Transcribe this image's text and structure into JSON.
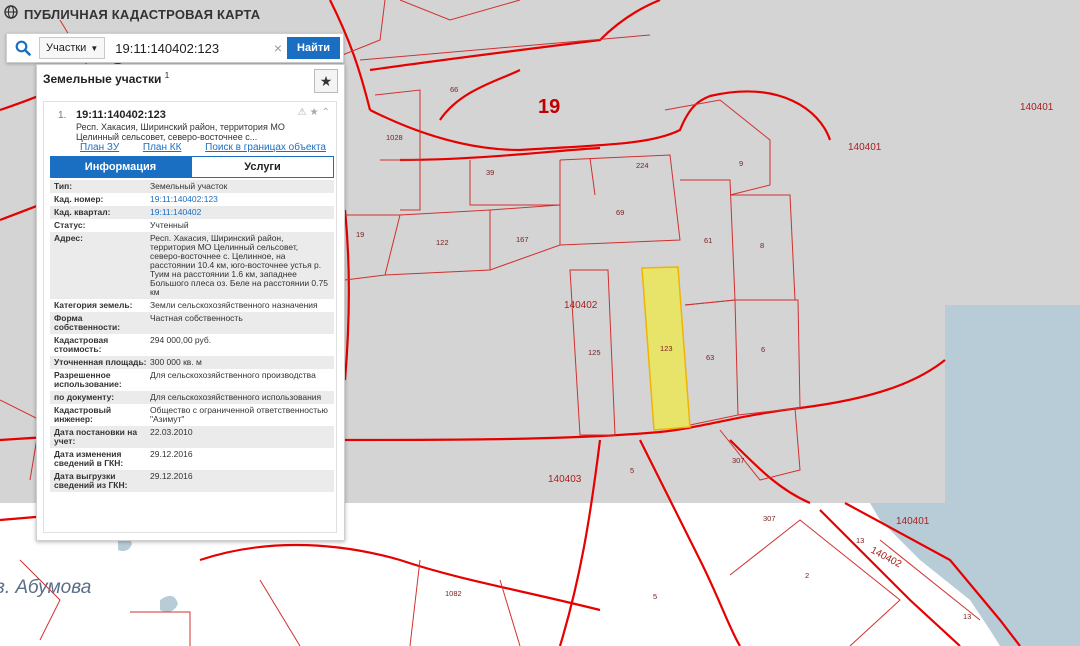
{
  "app": {
    "title": "ПУБЛИЧНАЯ КАДАСТРОВАЯ КАРТА",
    "logo": "globe-logo"
  },
  "search": {
    "type_label": "Участки",
    "query": "19:11:140402:123",
    "button_label": "Найти"
  },
  "panel": {
    "heading": "Земельные участки",
    "heading_count": "1",
    "item_number": "1.",
    "cad_number": "19:11:140402:123",
    "short_address": "Респ. Хакасия, Ширинский район, территория МО Целинный сельсовет, северо-восточнее с...",
    "links": [
      "План ЗУ →",
      "План КК →",
      "Поиск в границах объекта →"
    ],
    "tabs": [
      "Информация",
      "Услуги"
    ],
    "rows": [
      {
        "k": "Тип:",
        "v": "Земельный участок"
      },
      {
        "k": "Кад. номер:",
        "v": "19:11:140402:123",
        "link": true
      },
      {
        "k": "Кад. квартал:",
        "v": "19:11:140402",
        "link": true
      },
      {
        "k": "Статус:",
        "v": "Учтенный"
      },
      {
        "k": "Адрес:",
        "v": "Респ. Хакасия, Ширинский район, территория МО Целинный сельсовет, северо-восточнее с. Целинное, на расстоянии 10.4 км, юго-восточнее устья р. Туим на расстоянии 1.6 км, западнее Большого плеса оз. Беле на расстоянии 0.75 км"
      },
      {
        "k": "Категория земель:",
        "v": "Земли сельскохозяйственного назначения"
      },
      {
        "k": "Форма собственности:",
        "v": "Частная собственность"
      },
      {
        "k": "Кадастровая стоимость:",
        "v": "294 000,00 руб."
      },
      {
        "k": "Уточненная площадь:",
        "v": "300 000 кв. м"
      },
      {
        "k": "Разрешенное использование:",
        "v": "Для сельскохозяйственного производства"
      },
      {
        "k": "по документу:",
        "v": "Для сельскохозяйственного использования"
      },
      {
        "k": "Кадастровый инженер:",
        "v": "Общество с ограниченной ответственностью \"Азимут\""
      },
      {
        "k": "Дата постановки на учет:",
        "v": "22.03.2010"
      },
      {
        "k": "Дата изменения сведений в ГКН:",
        "v": "29.12.2016"
      },
      {
        "k": "Дата выгрузки сведений из ГКН:",
        "v": "29.12.2016"
      }
    ]
  },
  "map": {
    "place_label": "з. Абумова",
    "district_number": "19",
    "quarter_labels": [
      "140401",
      "140401",
      "140402",
      "140403",
      "140401",
      "140402"
    ],
    "parcel_labels": [
      "66",
      "1028",
      "224",
      "9",
      "39",
      "69",
      "19",
      "122",
      "167",
      "61",
      "8",
      "125",
      "123",
      "63",
      "6",
      "5",
      "307",
      "307",
      "13",
      "2",
      "1082",
      "5",
      "13"
    ],
    "colors": {
      "grey_area": "#d4d4d4",
      "water": "#b8ccd8",
      "boundary": "#e60000",
      "selected_fill": "#e8e46a",
      "selected_stroke": "#f0b400",
      "accent": "#1a6fc2"
    }
  }
}
